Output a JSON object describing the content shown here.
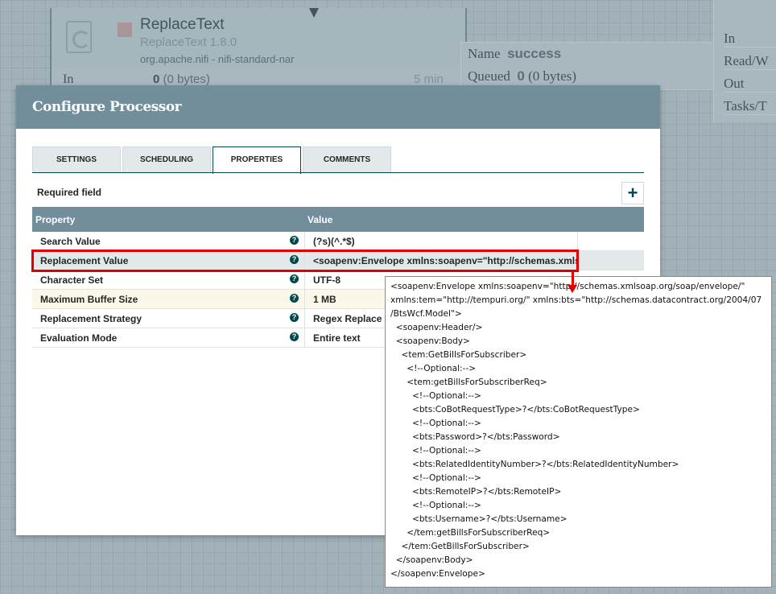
{
  "canvas": {
    "processor": {
      "name": "ReplaceText",
      "version": "ReplaceText 1.8.0",
      "bundle": "org.apache.nifi - nifi-standard-nar",
      "in_label": "In",
      "in_count": "0",
      "in_bytes": "(0 bytes)",
      "time": "5 min"
    },
    "connection": {
      "name_label": "Name",
      "name_value": "success",
      "queued_label": "Queued",
      "queued_count": "0",
      "queued_bytes": "(0 bytes)"
    },
    "right_panel": [
      "In",
      "Read/W",
      "Out",
      "Tasks/T"
    ]
  },
  "dialog": {
    "title": "Configure Processor",
    "tabs": [
      "SETTINGS",
      "SCHEDULING",
      "PROPERTIES",
      "COMMENTS"
    ],
    "active_tab": "PROPERTIES",
    "required_field": "Required field",
    "add_icon": "+",
    "columns": {
      "property": "Property",
      "value": "Value"
    },
    "rows": [
      {
        "property": "Search Value",
        "value": "(?s)(^.*$)"
      },
      {
        "property": "Replacement Value",
        "value": "<soapenv:Envelope xmlns:soapenv=\"http://schemas.xmlso..."
      },
      {
        "property": "Character Set",
        "value": "UTF-8"
      },
      {
        "property": "Maximum Buffer Size",
        "value": "1 MB"
      },
      {
        "property": "Replacement Strategy",
        "value": "Regex Replace"
      },
      {
        "property": "Evaluation Mode",
        "value": "Entire text"
      }
    ],
    "help_icon": "?"
  },
  "tooltip": {
    "text": "<soapenv:Envelope xmlns:soapenv=\"http://schemas.xmlsoap.org/soap/envelope/\"\nxmlns:tem=\"http://tempuri.org/\" xmlns:bts=\"http://schemas.datacontract.org/2004/07\n/BtsWcf.Model\">\n  <soapenv:Header/>\n  <soapenv:Body>\n    <tem:GetBillsForSubscriber>\n      <!--Optional:-->\n      <tem:getBillsForSubscriberReq>\n        <!--Optional:-->\n        <bts:CoBotRequestType>?</bts:CoBotRequestType>\n        <!--Optional:-->\n        <bts:Password>?</bts:Password>\n        <!--Optional:-->\n        <bts:RelatedIdentityNumber>?</bts:RelatedIdentityNumber>\n        <!--Optional:-->\n        <bts:RemoteIP>?</bts:RemoteIP>\n        <!--Optional:-->\n        <bts:Username>?</bts:Username>\n      </tem:getBillsForSubscriberReq>\n    </tem:GetBillsForSubscriber>\n  </soapenv:Body>\n</soapenv:Envelope>"
  }
}
